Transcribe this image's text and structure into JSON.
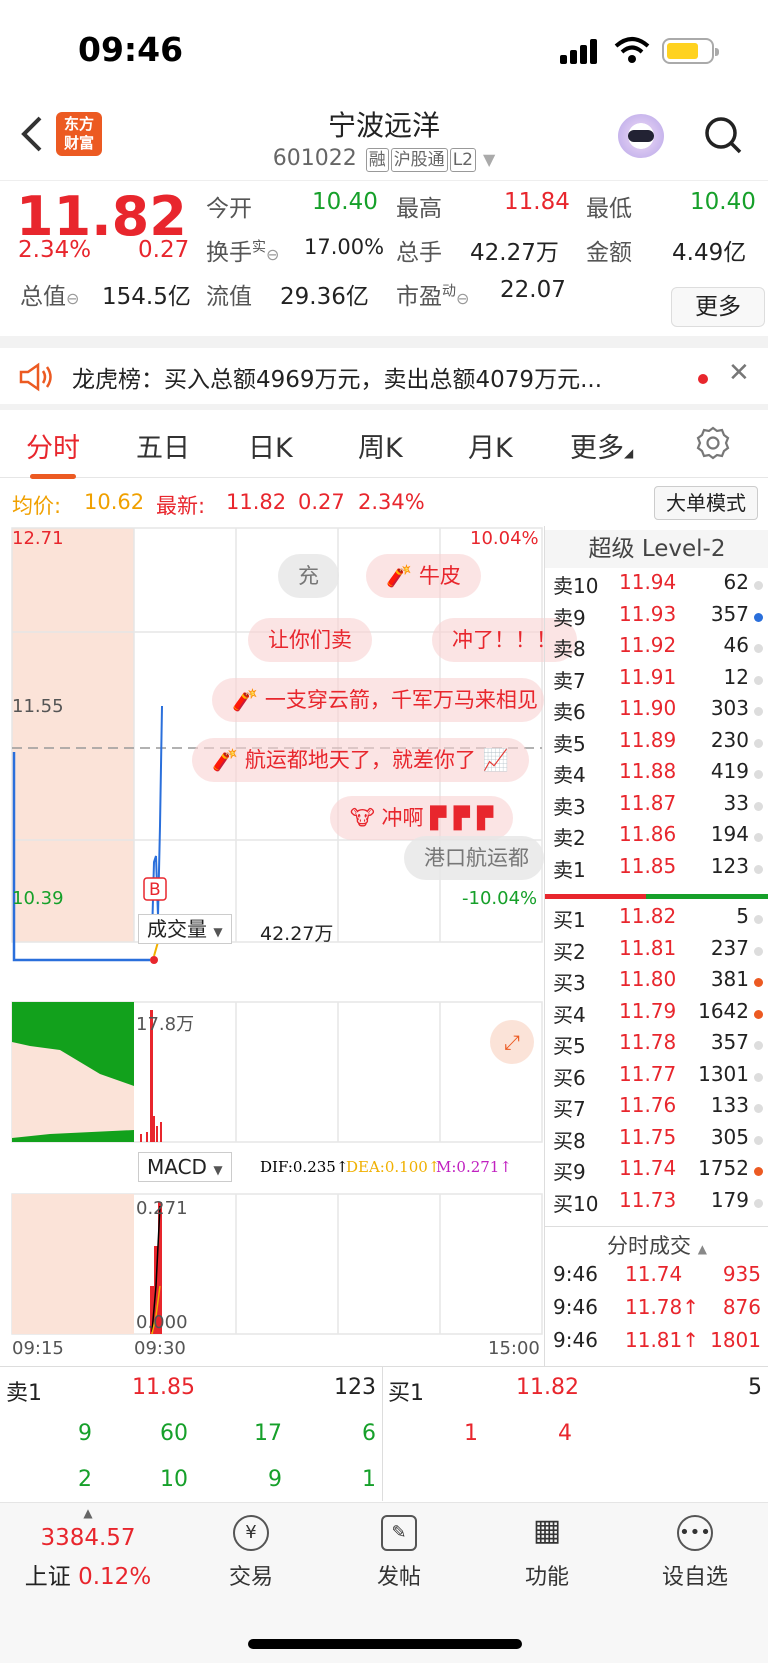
{
  "status": {
    "time": "09:46"
  },
  "header": {
    "logo_line1": "东方",
    "logo_line2": "财富",
    "name": "宁波远洋",
    "code": "601022",
    "tags": [
      "融",
      "沪股通",
      "L2"
    ]
  },
  "quote": {
    "price": "11.82",
    "pct": "2.34%",
    "chg": "0.27",
    "open_label": "今开",
    "open": "10.40",
    "high_label": "最高",
    "high": "11.84",
    "low_label": "最低",
    "low": "10.40",
    "turnover_label": "换手",
    "turnover_sup": "实",
    "turnover": "17.00%",
    "vol_label": "总手",
    "vol": "42.27万",
    "amount_label": "金额",
    "amount": "4.49亿",
    "mcap_label": "总值",
    "mcap": "154.5亿",
    "float_label": "流值",
    "float": "29.36亿",
    "pe_label": "市盈",
    "pe_sup": "动",
    "pe": "22.07",
    "more": "更多"
  },
  "notice": {
    "text": "龙虎榜：买入总额4969万元，卖出总额4079万元..."
  },
  "tabs": [
    "分时",
    "五日",
    "日K",
    "周K",
    "月K",
    "更多"
  ],
  "avgrow": {
    "avg_label": "均价:",
    "avg": "10.62",
    "latest_label": "最新:",
    "latest": "11.82",
    "chg": "0.27",
    "pct": "2.34%",
    "bigorder": "大单模式"
  },
  "chart": {
    "y_top": "12.71",
    "y_mid": "11.55",
    "y_bot": "10.39",
    "pct_top": "10.04%",
    "pct_bot": "-10.04%",
    "vol_label": "成交量",
    "vol_value": "42.27万",
    "vol_max": "17.8万",
    "macd_label": "MACD",
    "dif": "DIF:0.235↑",
    "dea": "DEA:0.100↑",
    "m": "M:0.271↑",
    "macd_top": "0.271",
    "macd_bot": "0.000",
    "t_start": "09:15",
    "t_open": "09:30",
    "t_end": "15:00",
    "marker": "B",
    "bubbles": [
      "充",
      "牛皮",
      "让你们卖",
      "冲了！！！",
      "一支穿云箭，千军万马来相见",
      "航运都地天了，就差你了",
      "冲啊",
      "港口航运都"
    ],
    "colors": {
      "up": "#e8262d",
      "down": "#16a02a",
      "price_line": "#2a6fdb",
      "avg_line": "#f0b000"
    }
  },
  "orderbook": {
    "title": "超级 Level-2",
    "sells": [
      [
        "卖10",
        "11.94",
        "62"
      ],
      [
        "卖9",
        "11.93",
        "357"
      ],
      [
        "卖8",
        "11.92",
        "46"
      ],
      [
        "卖7",
        "11.91",
        "12"
      ],
      [
        "卖6",
        "11.90",
        "303"
      ],
      [
        "卖5",
        "11.89",
        "230"
      ],
      [
        "卖4",
        "11.88",
        "419"
      ],
      [
        "卖3",
        "11.87",
        "33"
      ],
      [
        "卖2",
        "11.86",
        "194"
      ],
      [
        "卖1",
        "11.85",
        "123"
      ]
    ],
    "buys": [
      [
        "买1",
        "11.82",
        "5"
      ],
      [
        "买2",
        "11.81",
        "237"
      ],
      [
        "买3",
        "11.80",
        "381"
      ],
      [
        "买4",
        "11.79",
        "1642"
      ],
      [
        "买5",
        "11.78",
        "357"
      ],
      [
        "买6",
        "11.77",
        "1301"
      ],
      [
        "买7",
        "11.76",
        "133"
      ],
      [
        "买8",
        "11.75",
        "305"
      ],
      [
        "买9",
        "11.74",
        "1752"
      ],
      [
        "买10",
        "11.73",
        "179"
      ]
    ],
    "trades_title": "分时成交",
    "trades": [
      [
        "9:46",
        "11.74",
        "935"
      ],
      [
        "9:46",
        "11.78↑",
        "876"
      ],
      [
        "9:46",
        "11.81↑",
        "1801"
      ]
    ]
  },
  "bottom": {
    "sell1_label": "卖1",
    "sell1_price": "11.85",
    "sell1_vol": "123",
    "buy1_label": "买1",
    "buy1_price": "11.82",
    "buy1_vol": "5",
    "sell_row1": [
      "9",
      "60",
      "17",
      "6"
    ],
    "sell_row2": [
      "2",
      "10",
      "9",
      "1"
    ],
    "buy_row1": [
      "1",
      "4"
    ]
  },
  "toolbar": {
    "index_value": "3384.57",
    "index_name": "上证",
    "index_pct": "0.12%",
    "trade": "交易",
    "post": "发帖",
    "func": "功能",
    "fav": "设自选"
  }
}
